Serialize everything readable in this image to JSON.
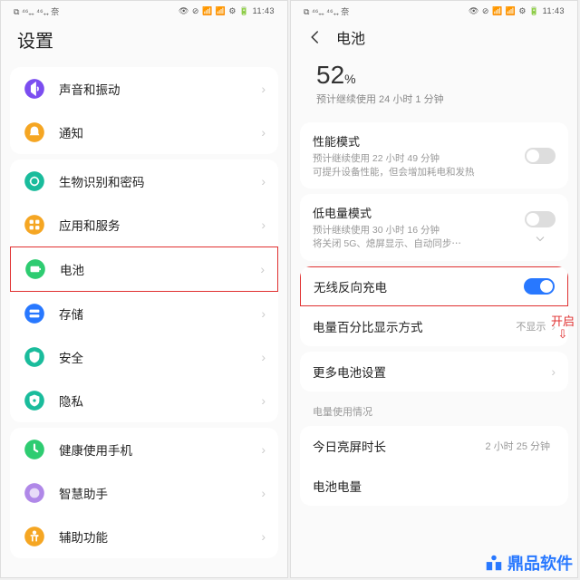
{
  "statusbar": {
    "left": "⧉ ⁴⁶₊₊ ⁴⁶₊₊ 奈",
    "right": "👁 ⊘ 📶 📶 ⚙ 🔋 11:43"
  },
  "left": {
    "title": "设置",
    "items": [
      {
        "label": "声音和振动",
        "color": "#7b4df0"
      },
      {
        "label": "通知",
        "color": "#f5a623"
      },
      {
        "label": "生物识别和密码",
        "color": "#1abc9c"
      },
      {
        "label": "应用和服务",
        "color": "#f5a623"
      },
      {
        "label": "电池",
        "color": "#2ecc71",
        "hl": true
      },
      {
        "label": "存储",
        "color": "#2878ff"
      },
      {
        "label": "安全",
        "color": "#1abc9c"
      },
      {
        "label": "隐私",
        "color": "#1abc9c"
      },
      {
        "label": "健康使用手机",
        "color": "#2ecc71"
      },
      {
        "label": "智慧助手",
        "color": "#b088e8"
      },
      {
        "label": "辅助功能",
        "color": "#f5a623"
      }
    ]
  },
  "right": {
    "title": "电池",
    "pct": "52",
    "pct_unit": "%",
    "estimate": "预计继续使用 24 小时 1 分钟",
    "perf": {
      "title": "性能模式",
      "sub1": "预计继续使用 22 小时 49 分钟",
      "sub2": "可提升设备性能，但会增加耗电和发热"
    },
    "low": {
      "title": "低电量模式",
      "sub1": "预计继续使用 30 小时 16 分钟",
      "sub2": "将关闭 5G、熄屏显示、自动同步⋯"
    },
    "reverse": {
      "title": "无线反向充电"
    },
    "display": {
      "title": "电量百分比显示方式",
      "value": "不显示"
    },
    "more": "更多电池设置",
    "section": "电量使用情况",
    "today": {
      "title": "今日亮屏时长",
      "value": "2 小时 25 分钟"
    },
    "usage": "电池电量"
  },
  "annot": {
    "label": "开启",
    "arrow": "⇩"
  },
  "watermark": "鼎品软件"
}
